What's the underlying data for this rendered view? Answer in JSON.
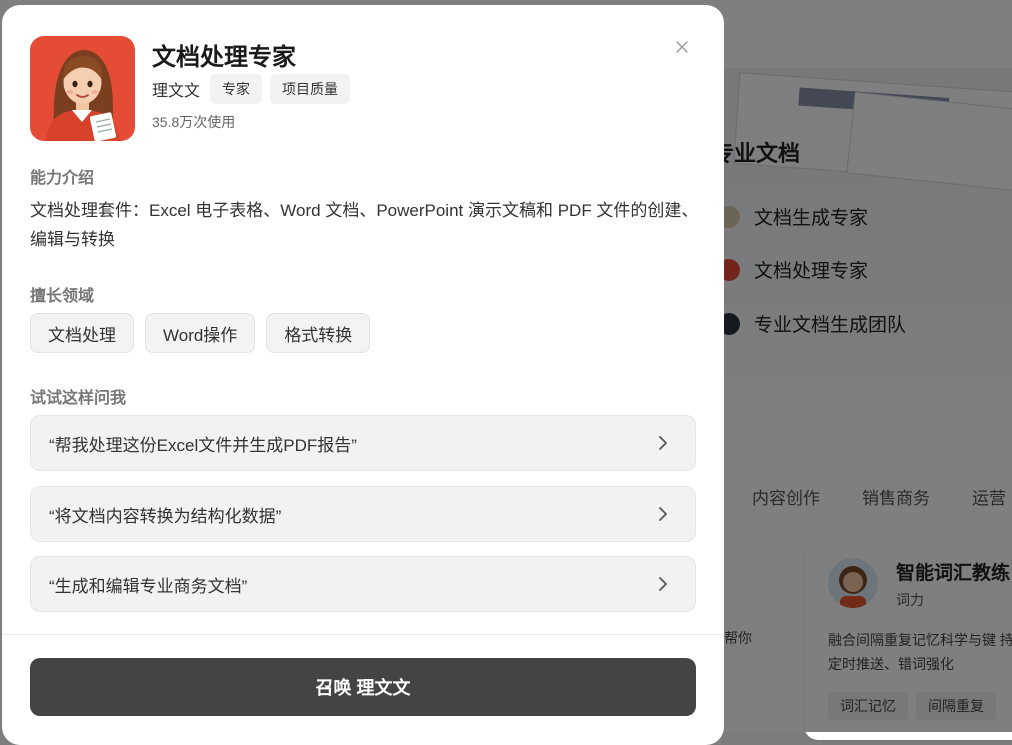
{
  "background": {
    "heading": "专业文档",
    "experts": [
      "文档生成专家",
      "文档处理专家",
      "专业文档生成团队"
    ],
    "categories": [
      "内容创作",
      "销售商务",
      "运营"
    ],
    "card": {
      "title": "智能词汇教练",
      "author": "词力",
      "description": "融合间隔重复记忆科学与键 持每日定时推送、错词强化",
      "tags": [
        "词汇记忆",
        "间隔重复"
      ]
    },
    "helper_text": "帮你"
  },
  "modal": {
    "title": "文档处理专家",
    "author": "理文文",
    "tags": [
      "专家",
      "项目质量"
    ],
    "usage": "35.8万次使用",
    "close_icon": "close-icon",
    "intro_label": "能力介绍",
    "intro_text": "文档处理套件：Excel 电子表格、Word 文档、PowerPoint 演示文稿和 PDF 文件的创建、编辑与转换",
    "skills_label": "擅长领域",
    "skills": [
      "文档处理",
      "Word操作",
      "格式转换"
    ],
    "examples_label": "试试这样问我",
    "examples": [
      "“帮我处理这份Excel文件并生成PDF报告”",
      "“将文档内容转换为结构化数据”",
      "“生成和编辑专业商务文档”"
    ],
    "summon_label": "召唤 理文文"
  },
  "colors": {
    "avatar_bg": "#e44c36",
    "button_bg": "#444444",
    "overlay": "rgba(0,0,0,0.5)"
  }
}
